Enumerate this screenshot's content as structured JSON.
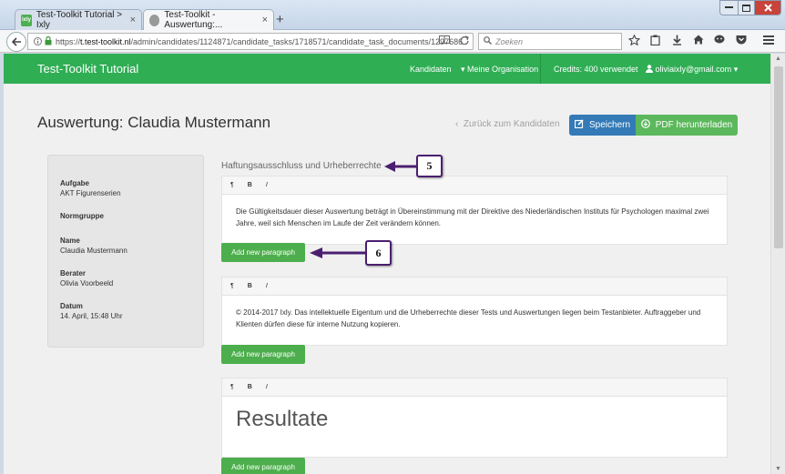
{
  "browser": {
    "tabs": [
      {
        "title": "Test-Toolkit Tutorial > Ixly",
        "favicon": "ixly"
      },
      {
        "title": "Test-Toolkit - Auswertung:...",
        "favicon": "owl"
      }
    ],
    "url_prefix": "https://",
    "url_host": "t.test-toolkit.nl",
    "url_path": "/admin/candidates/1124871/candidate_tasks/1718571/candidate_task_documents/1297686",
    "search_placeholder": "Zoeken",
    "close_glyph": "×",
    "new_tab_glyph": "+"
  },
  "app": {
    "brand": "Test-Toolkit Tutorial",
    "nav": {
      "candidates": "Kandidaten",
      "organisation": "Meine Organisation",
      "credits": "Credits: 400 verwendet",
      "user": "oliviaixly@gmail.com"
    }
  },
  "page": {
    "title": "Auswertung: Claudia Mustermann",
    "back_link": "Zurück zum Kandidaten",
    "save_label": "Speichern",
    "pdf_label": "PDF herunterladen"
  },
  "sidebar": {
    "items": [
      {
        "label": "Aufgabe",
        "value": "AKT Figurenserien"
      },
      {
        "label": "Normgruppe",
        "value": ""
      },
      {
        "label": "Name",
        "value": "Claudia Mustermann"
      },
      {
        "label": "Berater",
        "value": "Olivia Voorbeeld"
      },
      {
        "label": "Datum",
        "value": "14. April, 15:48 Uhr"
      }
    ]
  },
  "main": {
    "section_heading": "Haftungsausschluss und Urheberrechte",
    "toolbar": {
      "paragraph": "¶",
      "bold": "B",
      "italic": "I"
    },
    "paragraphs": [
      "Die Gültigkeitsdauer dieser Auswertung beträgt in Übereinstimmung mit der Direktive des Niederländischen Instituts für Psychologen maximal zwei Jahre, weil sich Menschen im Laufe der Zeit verändern können.",
      "© 2014-2017 Ixly. Das intellektuelle Eigentum und die Urheberrechte dieser Tests und Auswertungen liegen beim Testanbieter. Auftraggeber und Klienten dürfen diese für interne Nutzung kopieren.",
      "Resultate"
    ],
    "add_paragraph_label": "Add new paragraph"
  },
  "callouts": {
    "first": "5",
    "second": "6"
  },
  "colors": {
    "brand_green": "#2fae54",
    "save_blue": "#337ab7",
    "pdf_green": "#5cb85c",
    "callout_purple": "#4b1f6f"
  }
}
